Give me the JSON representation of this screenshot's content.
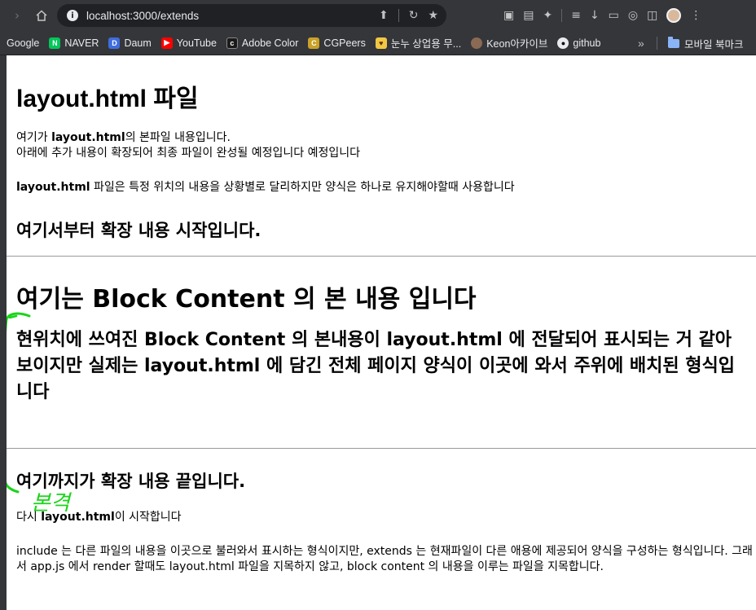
{
  "browser": {
    "url": "localhost:3000/extends",
    "bookmarks": [
      {
        "label": "Google",
        "icon": "google-icon"
      },
      {
        "label": "NAVER",
        "icon": "naver-icon"
      },
      {
        "label": "Daum",
        "icon": "daum-icon"
      },
      {
        "label": "YouTube",
        "icon": "youtube-icon"
      },
      {
        "label": "Adobe Color",
        "icon": "adobe-color-icon"
      },
      {
        "label": "CGPeers",
        "icon": "cgpeers-icon"
      },
      {
        "label": "눈누 상업용 무...",
        "icon": "noonnu-icon"
      },
      {
        "label": "Keon아카이브",
        "icon": "keon-archive-icon"
      },
      {
        "label": "github",
        "icon": "github-icon"
      }
    ],
    "overflow": "»",
    "mobile_bookmarks": "모바일 북마크"
  },
  "page": {
    "title": "layout.html 파일",
    "intro_line1_pre": "여기가 ",
    "intro_line1_bold": "layout.html",
    "intro_line1_post": "의 본파일 내용입니다.",
    "intro_line2": "아래에 추가 내용이 확장되어 최종 파일이 완성될 예정입니다 예정입니다",
    "usage_bold": "layout.html",
    "usage_post": " 파일은 특정 위치의 내용을 상황별로 달리하지만 양식은 하나로 유지해야할때 사용합니다",
    "extend_start": "여기서부터 확장 내용 시작입니다.",
    "block_title": "여기는 Block Content 의 본 내용 입니다",
    "block_body": "현위치에 쓰여진 Block Content 의 본내용이 layout.html 에 전달되어 표시되는 거 같아 보이지만 실제는 layout.html 에 담긴 전체 페이지 양식이 이곳에 와서 주위에 배치된 형식입니다",
    "extend_end": "여기까지가 확장 내용 끝입니다.",
    "resume_bold": "layout.html",
    "resume_pre": "다시 ",
    "resume_post": "이 시작합니다",
    "explain": "include 는 다른 파일의 내용을 이곳으로 불러와서 표시하는 형식이지만, extends 는 현재파일이 다른 애용에 제공되어 양식을 구성하는 형식입니다. 그래서 app.js 에서 render 할때도 layout.html 파일을 지목하지 않고, block content 의 내용을 이루는 파일을 지목합니다.",
    "handwritten_note": "본격"
  },
  "colors": {
    "chrome": "#35363a",
    "annotation": "#19d519"
  }
}
